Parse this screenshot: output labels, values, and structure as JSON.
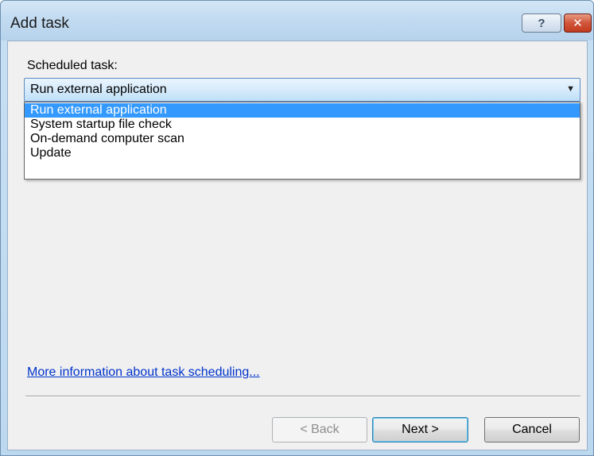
{
  "window": {
    "title": "Add task",
    "help_glyph": "?",
    "close_glyph": "✕"
  },
  "scheduled_task": {
    "label": "Scheduled task:",
    "selected_value": "Run external application",
    "options": [
      "Run external application",
      "System startup file check",
      "On-demand computer scan",
      "Update"
    ],
    "selected_index": 0
  },
  "link": {
    "text": "More information about task scheduling..."
  },
  "buttons": {
    "back": "< Back",
    "next": "Next >",
    "cancel": "Cancel"
  },
  "icons": {
    "help": "help-icon",
    "close": "close-icon",
    "dropdown": "chevron-down-icon"
  },
  "colors": {
    "selection": "#3399ff",
    "link": "#0033cc",
    "close_button": "#c23b1f"
  }
}
